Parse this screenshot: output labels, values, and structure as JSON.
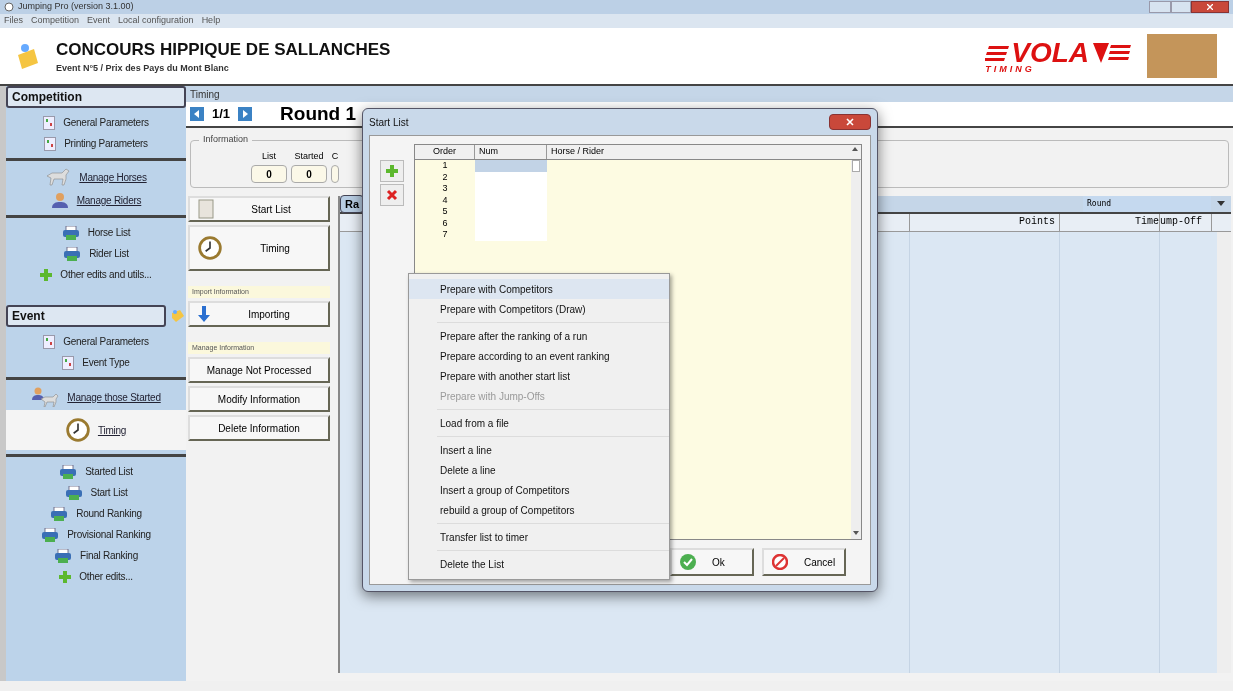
{
  "window": {
    "title": "Jumping Pro (version 3.1.00)"
  },
  "menu_bar": [
    "Files",
    "Competition",
    "Event",
    "Local configuration",
    "Help"
  ],
  "header": {
    "title": "CONCOURS HIPPIQUE DE SALLANCHES",
    "subtitle": "Event N°5 / Prix des Pays du Mont Blanc",
    "logo_word": "VOLA",
    "logo_sub": "TIMING"
  },
  "sidebar": {
    "sections": [
      {
        "title": "Competition",
        "groups": [
          [
            {
              "label": "General Parameters",
              "kind": "param",
              "selected": false
            },
            {
              "label": "Printing Parameters",
              "kind": "param",
              "selected": false
            }
          ],
          [
            {
              "label": "Manage Horses",
              "kind": "horse",
              "selected": false
            },
            {
              "label": "Manage Riders",
              "kind": "rider",
              "selected": false
            }
          ],
          [
            {
              "label": "Horse List",
              "kind": "print",
              "selected": false
            },
            {
              "label": "Rider List",
              "kind": "print",
              "selected": false
            },
            {
              "label": "Other edits and utils...",
              "kind": "more",
              "selected": false
            }
          ]
        ]
      },
      {
        "title": "Event",
        "groups": [
          [
            {
              "label": "General Parameters",
              "kind": "param",
              "selected": false
            },
            {
              "label": "Event Type",
              "kind": "param",
              "selected": false
            }
          ],
          [
            {
              "label": "Manage those Started",
              "kind": "started",
              "selected": false
            },
            {
              "label": "Timing",
              "kind": "clock",
              "selected": true
            }
          ],
          [
            {
              "label": "Started List",
              "kind": "print",
              "selected": false
            },
            {
              "label": "Start List",
              "kind": "print",
              "selected": false
            },
            {
              "label": "Round Ranking",
              "kind": "print",
              "selected": false
            },
            {
              "label": "Provisional Ranking",
              "kind": "print",
              "selected": false
            },
            {
              "label": "Final Ranking",
              "kind": "print",
              "selected": false
            },
            {
              "label": "Other edits...",
              "kind": "more",
              "selected": false
            }
          ]
        ]
      }
    ]
  },
  "main": {
    "section_title": "Timing",
    "pager": "1/1",
    "round_title": "Round 1",
    "information": {
      "title": "Information",
      "fields": [
        {
          "label": "List",
          "value": "0"
        },
        {
          "label": "Started",
          "value": "0"
        },
        {
          "label": "C"
        }
      ]
    },
    "actions": [
      {
        "kind": "list",
        "label": "Start List"
      },
      {
        "kind": "clock",
        "label": "Timing"
      },
      {
        "kind": "heading",
        "label": "Import Information"
      },
      {
        "kind": "import",
        "label": "Importing"
      },
      {
        "kind": "heading",
        "label": "Manage Information"
      },
      {
        "kind": "button",
        "label": "Manage Not Processed"
      },
      {
        "kind": "button",
        "label": "Modify Information"
      },
      {
        "kind": "button",
        "label": "Delete Information"
      }
    ],
    "grid": {
      "tab": "Ra",
      "view": "Round",
      "columns": [
        "Points",
        "Time",
        "ump-Off"
      ]
    }
  },
  "dialog": {
    "title": "Start List",
    "columns": [
      "Order",
      "Num",
      "Horse / Rider"
    ],
    "rows": [
      {
        "order": "1",
        "selected": true
      },
      {
        "order": "2",
        "selected": false
      },
      {
        "order": "3",
        "selected": false
      },
      {
        "order": "4",
        "selected": false
      },
      {
        "order": "5",
        "selected": false
      },
      {
        "order": "6",
        "selected": false
      },
      {
        "order": "7",
        "selected": false
      }
    ],
    "buttons": [
      {
        "label": "Ok",
        "kind": "ok"
      },
      {
        "label": "Cancel",
        "kind": "cancel"
      }
    ]
  },
  "context_menu": {
    "groups": [
      [
        {
          "label": "Prepare with Competitors",
          "selected": true,
          "disabled": false
        },
        {
          "label": "Prepare with Competitors (Draw)",
          "selected": false,
          "disabled": false
        }
      ],
      [
        {
          "label": "Prepare after the ranking of a run",
          "selected": false,
          "disabled": false
        },
        {
          "label": "Prepare according to an event ranking",
          "selected": false,
          "disabled": false
        },
        {
          "label": "Prepare with another start list",
          "selected": false,
          "disabled": false
        },
        {
          "label": "Prepare with Jump-Offs",
          "selected": false,
          "disabled": true
        }
      ],
      [
        {
          "label": "Load from a file",
          "selected": false,
          "disabled": false
        }
      ],
      [
        {
          "label": "Insert a line",
          "selected": false,
          "disabled": false
        },
        {
          "label": "Delete a line",
          "selected": false,
          "disabled": false
        },
        {
          "label": "Insert a group of Competitors",
          "selected": false,
          "disabled": false
        },
        {
          "label": "rebuild a group of Competitors",
          "selected": false,
          "disabled": false
        }
      ],
      [
        {
          "label": "Transfer list to timer",
          "selected": false,
          "disabled": false
        }
      ],
      [
        {
          "label": "Delete the List",
          "selected": false,
          "disabled": false
        }
      ]
    ]
  }
}
